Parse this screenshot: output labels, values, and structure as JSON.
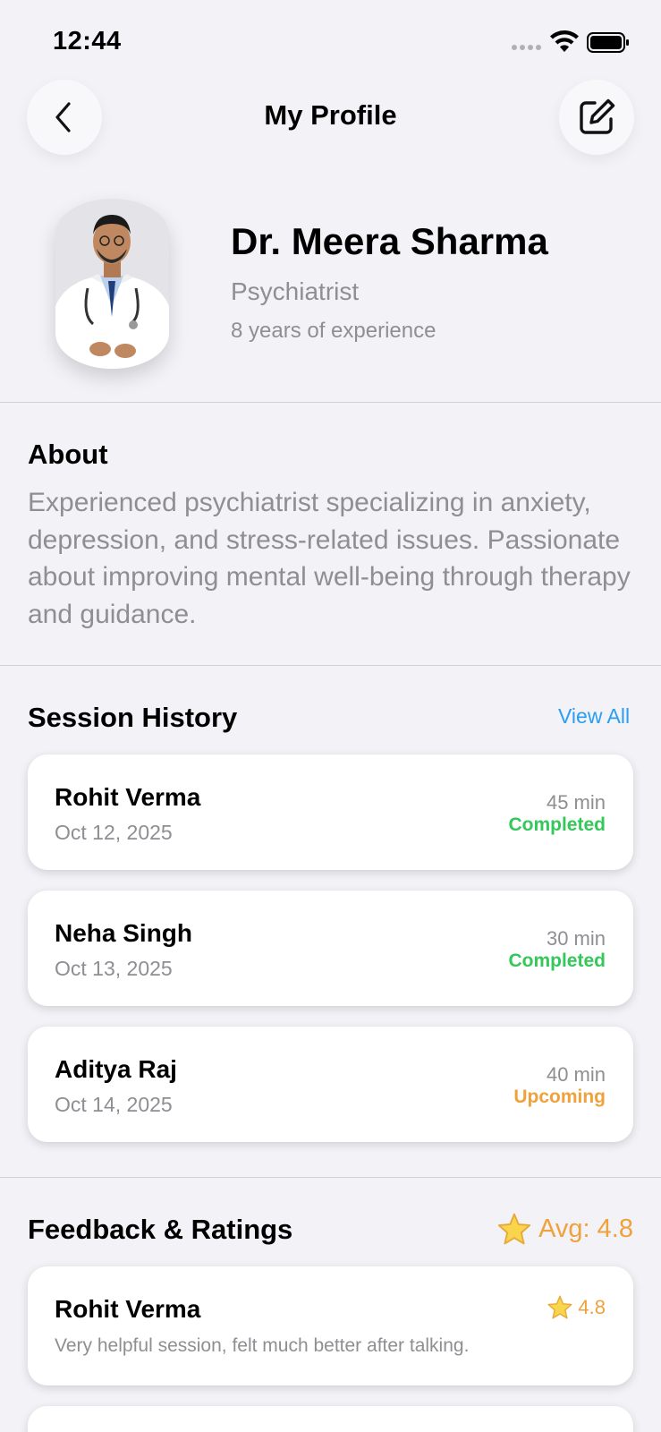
{
  "status_bar": {
    "time": "12:44"
  },
  "nav": {
    "title": "My Profile"
  },
  "profile": {
    "name": "Dr. Meera Sharma",
    "specialty": "Psychiatrist",
    "experience": "8 years of experience"
  },
  "about": {
    "title": "About",
    "text": "Experienced psychiatrist specializing in anxiety, depression, and stress-related issues. Passionate about improving mental well-being through therapy and guidance."
  },
  "sessions": {
    "title": "Session History",
    "view_all": "View All",
    "items": [
      {
        "name": "Rohit Verma",
        "date": "Oct 12, 2025",
        "duration": "45 min",
        "status": "Completed",
        "status_color": "#34c759"
      },
      {
        "name": "Neha Singh",
        "date": "Oct 13, 2025",
        "duration": "30 min",
        "status": "Completed",
        "status_color": "#34c759"
      },
      {
        "name": "Aditya Raj",
        "date": "Oct 14, 2025",
        "duration": "40 min",
        "status": "Upcoming",
        "status_color": "#f0a13c"
      }
    ]
  },
  "feedback": {
    "title": "Feedback & Ratings",
    "average": "Avg: 4.8",
    "items": [
      {
        "name": "Rohit Verma",
        "rating": "4.8",
        "comment": "Very helpful session, felt much better after talking."
      }
    ]
  },
  "colors": {
    "accent": "#2a9df4",
    "completed": "#34c759",
    "upcoming": "#f0a13c",
    "background": "#f2f2f7"
  },
  "icons": [
    "back-chevron-icon",
    "edit-icon",
    "wifi-icon",
    "battery-icon",
    "signal-icon",
    "star-icon"
  ]
}
